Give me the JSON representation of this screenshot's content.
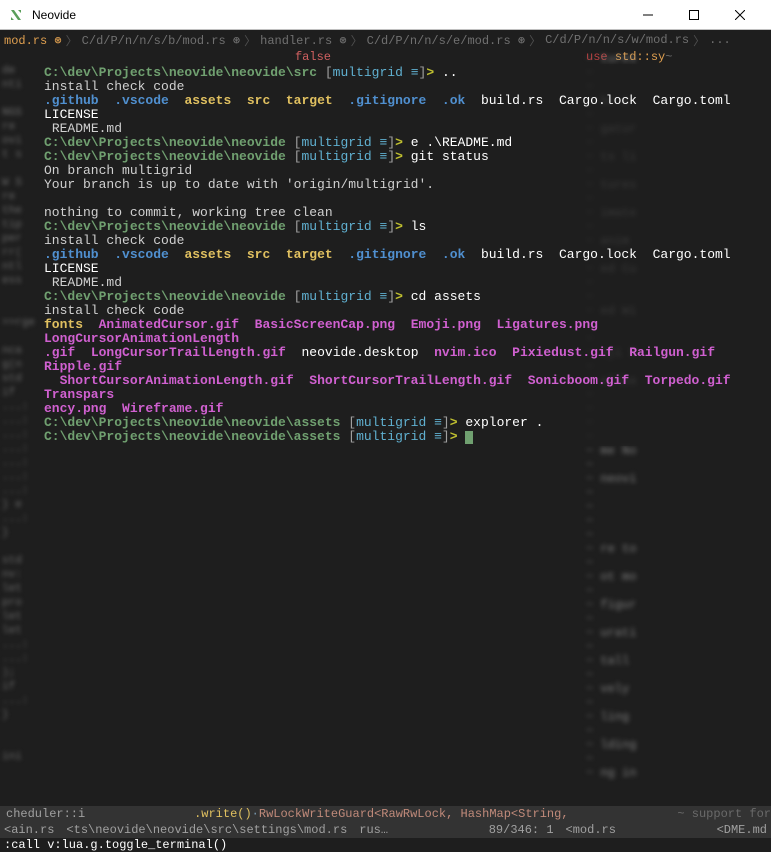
{
  "window": {
    "title": "Neovide"
  },
  "tabs": {
    "items": [
      {
        "label": "mod.rs",
        "modified": true,
        "active": true
      },
      {
        "label": "C/d/P/n/n/s/b/mod.rs",
        "modified": true
      },
      {
        "label": "handler.rs",
        "modified": true
      },
      {
        "label": "C/d/P/n/n/s/e/mod.rs",
        "modified": true
      },
      {
        "label": "C/d/P/n/n/s/w/mod.rs"
      },
      {
        "label": "..."
      }
    ]
  },
  "status_overlay": {
    "center": "false",
    "right_use": "use",
    "right_std": "std::sy",
    "right_tilde": "~"
  },
  "terminal": {
    "prompt_path_main": "C:\\dev\\Projects\\neovide\\neovide\\src",
    "prompt_path_root": "C:\\dev\\Projects\\neovide\\neovide",
    "prompt_path_assets": "C:\\dev\\Projects\\neovide\\neovide\\assets",
    "branch": "multigrid",
    "equals": "≡",
    "arrow": ">",
    "lines": [
      {
        "type": "prompt",
        "path_key": "prompt_path_main",
        "cmd": ".."
      },
      {
        "type": "output",
        "text": "install check code"
      },
      {
        "type": "ls",
        "items": [
          {
            "t": "dir",
            "v": ".github"
          },
          {
            "t": "dir",
            "v": ".vscode"
          },
          {
            "t": "fy",
            "v": "assets"
          },
          {
            "t": "fy",
            "v": "src"
          },
          {
            "t": "fy",
            "v": "target"
          },
          {
            "t": "dir",
            "v": ".gitignore"
          },
          {
            "t": "dir",
            "v": ".ok"
          },
          {
            "t": "f",
            "v": "build.rs"
          },
          {
            "t": "f",
            "v": "Cargo.lock"
          },
          {
            "t": "f",
            "v": "Cargo.toml"
          },
          {
            "t": "f",
            "v": "LICENSE"
          }
        ]
      },
      {
        "type": "output",
        "text": " README.md"
      },
      {
        "type": "prompt",
        "path_key": "prompt_path_root",
        "cmd": "e .\\README.md"
      },
      {
        "type": "prompt",
        "path_key": "prompt_path_root",
        "cmd": "git status"
      },
      {
        "type": "output",
        "text": "On branch multigrid"
      },
      {
        "type": "output",
        "text": "Your branch is up to date with 'origin/multigrid'."
      },
      {
        "type": "blank"
      },
      {
        "type": "output",
        "text": "nothing to commit, working tree clean"
      },
      {
        "type": "prompt",
        "path_key": "prompt_path_root",
        "cmd": "ls"
      },
      {
        "type": "output",
        "text": "install check code"
      },
      {
        "type": "ls",
        "items": [
          {
            "t": "dir",
            "v": ".github"
          },
          {
            "t": "dir",
            "v": ".vscode"
          },
          {
            "t": "fy",
            "v": "assets"
          },
          {
            "t": "fy",
            "v": "src"
          },
          {
            "t": "fy",
            "v": "target"
          },
          {
            "t": "dir",
            "v": ".gitignore"
          },
          {
            "t": "dir",
            "v": ".ok"
          },
          {
            "t": "f",
            "v": "build.rs"
          },
          {
            "t": "f",
            "v": "Cargo.lock"
          },
          {
            "t": "f",
            "v": "Cargo.toml"
          },
          {
            "t": "f",
            "v": "LICENSE"
          }
        ]
      },
      {
        "type": "output",
        "text": " README.md"
      },
      {
        "type": "prompt",
        "path_key": "prompt_path_root",
        "cmd": "cd assets"
      },
      {
        "type": "output",
        "text": "install check code"
      },
      {
        "type": "ls",
        "items": [
          {
            "t": "fy",
            "v": "fonts"
          },
          {
            "t": "img",
            "v": "AnimatedCursor.gif"
          },
          {
            "t": "img",
            "v": "BasicScreenCap.png"
          },
          {
            "t": "img",
            "v": "Emoji.png"
          },
          {
            "t": "img",
            "v": "Ligatures.png"
          },
          {
            "t": "img",
            "v": "LongCursorAnimationLength"
          }
        ]
      },
      {
        "type": "ls",
        "items": [
          {
            "t": "img",
            "v": ".gif"
          },
          {
            "t": "img",
            "v": "LongCursorTrailLength.gif"
          },
          {
            "t": "f",
            "v": "neovide.desktop"
          },
          {
            "t": "img",
            "v": "nvim.ico"
          },
          {
            "t": "img",
            "v": "Pixiedust.gif"
          },
          {
            "t": "img",
            "v": "Railgun.gif"
          },
          {
            "t": "img",
            "v": "Ripple.gif"
          }
        ]
      },
      {
        "type": "ls",
        "items": [
          {
            "t": "img",
            "v": "  ShortCursorAnimationLength.gif"
          },
          {
            "t": "img",
            "v": "ShortCursorTrailLength.gif"
          },
          {
            "t": "img",
            "v": "Sonicboom.gif"
          },
          {
            "t": "img",
            "v": "Torpedo.gif"
          },
          {
            "t": "img",
            "v": "Transpars"
          }
        ]
      },
      {
        "type": "ls",
        "items": [
          {
            "t": "img",
            "v": "ency.png"
          },
          {
            "t": "img",
            "v": "Wireframe.gif"
          }
        ]
      },
      {
        "type": "prompt",
        "path_key": "prompt_path_assets",
        "cmd": "explorer ."
      },
      {
        "type": "prompt_cursor",
        "path_key": "prompt_path_assets"
      }
    ]
  },
  "mid_status": {
    "left": "cheduler::i",
    "write": ".write()",
    "type": "RwLockWriteGuard<RawRwLock, HashMap<String,",
    "right": "~ support for"
  },
  "bottom_status": {
    "file1": "<ain.rs",
    "path": "<ts\\neovide\\neovide\\src\\settings\\mod.rs",
    "lang": "rus…",
    "pos": "89/346:  1",
    "file2": "<mod.rs",
    "file3": "<DME.md"
  },
  "command_line": ":call v:lua.g.toggle_terminal()",
  "bg_code": {
    "lines": [
      "de",
      "nti",
      "",
      "NGS",
      " re",
      "ovi",
      "t s",
      "",
      "W S",
      " re",
      "the",
      "tip",
      "per",
      "rr(",
      "ntl",
      "ess",
      "",
      "",
      ">>rge",
      "",
      "nca",
      "g(n",
      "std",
      "if ",
      "...:",
      "...:",
      "...:",
      "...:",
      "...:",
      "...:",
      "...:",
      "} e",
      "...:",
      "}",
      "",
      "std",
      "nv:",
      "let",
      "pro",
      "let",
      "let",
      "...:",
      "...:",
      ");",
      "if ",
      "...:",
      "}",
      "",
      "",
      "ini"
    ]
  },
  "right_bg": {
    "lines": [
      "tures",
      "",
      "",
      "be a",
      "",
      "gatur",
      "",
      "ts li",
      "",
      "tures",
      "",
      "imate",
      "",
      "anim",
      "",
      "ed Cu",
      "",
      "",
      "ed Wi",
      "",
      "",
      "oji S",
      "",
      "allba",
      "",
      "",
      "",
      "",
      "me No",
      "",
      "neovi",
      "",
      "",
      "",
      "",
      "re to",
      "",
      "ot mo",
      "",
      "figur",
      "",
      "urati",
      "",
      "tall ",
      "",
      "vely ",
      "",
      "ling ",
      "",
      "lding",
      "",
      "ng in"
    ]
  }
}
